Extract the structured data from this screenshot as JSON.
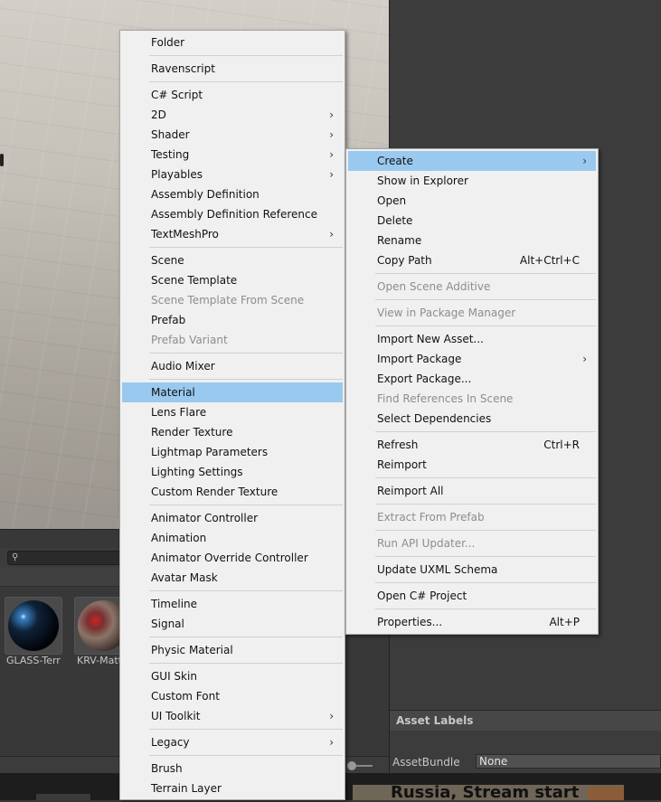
{
  "project_panel": {
    "assets": [
      {
        "name": "GLASS-Terr"
      },
      {
        "name": "KRV-Matt"
      }
    ]
  },
  "inspector": {
    "asset_labels_title": "Asset Labels",
    "assetbundle_label": "AssetBundle",
    "assetbundle_value": "None"
  },
  "bottom_strip": {
    "text": "Russia, Stream start"
  },
  "create_menu": {
    "items": [
      {
        "label": "Folder"
      },
      {
        "label": "Ravenscript"
      },
      {
        "label": "C# Script"
      },
      {
        "label": "2D",
        "submenu": true
      },
      {
        "label": "Shader",
        "submenu": true
      },
      {
        "label": "Testing",
        "submenu": true
      },
      {
        "label": "Playables",
        "submenu": true
      },
      {
        "label": "Assembly Definition"
      },
      {
        "label": "Assembly Definition Reference"
      },
      {
        "label": "TextMeshPro",
        "submenu": true
      },
      {
        "label": "Scene"
      },
      {
        "label": "Scene Template"
      },
      {
        "label": "Scene Template From Scene",
        "disabled": true
      },
      {
        "label": "Prefab"
      },
      {
        "label": "Prefab Variant",
        "disabled": true
      },
      {
        "label": "Audio Mixer"
      },
      {
        "label": "Material",
        "highlighted": true
      },
      {
        "label": "Lens Flare"
      },
      {
        "label": "Render Texture"
      },
      {
        "label": "Lightmap Parameters"
      },
      {
        "label": "Lighting Settings"
      },
      {
        "label": "Custom Render Texture"
      },
      {
        "label": "Animator Controller"
      },
      {
        "label": "Animation"
      },
      {
        "label": "Animator Override Controller"
      },
      {
        "label": "Avatar Mask"
      },
      {
        "label": "Timeline"
      },
      {
        "label": "Signal"
      },
      {
        "label": "Physic Material"
      },
      {
        "label": "GUI Skin"
      },
      {
        "label": "Custom Font"
      },
      {
        "label": "UI Toolkit",
        "submenu": true
      },
      {
        "label": "Legacy",
        "submenu": true
      },
      {
        "label": "Brush"
      },
      {
        "label": "Terrain Layer"
      }
    ]
  },
  "context_menu": {
    "items": [
      {
        "label": "Create",
        "submenu": true,
        "highlighted": true
      },
      {
        "label": "Show in Explorer"
      },
      {
        "label": "Open"
      },
      {
        "label": "Delete"
      },
      {
        "label": "Rename"
      },
      {
        "label": "Copy Path",
        "shortcut": "Alt+Ctrl+C"
      },
      {
        "label": "Open Scene Additive",
        "disabled": true
      },
      {
        "label": "View in Package Manager",
        "disabled": true
      },
      {
        "label": "Import New Asset..."
      },
      {
        "label": "Import Package",
        "submenu": true
      },
      {
        "label": "Export Package..."
      },
      {
        "label": "Find References In Scene",
        "disabled": true
      },
      {
        "label": "Select Dependencies"
      },
      {
        "label": "Refresh",
        "shortcut": "Ctrl+R"
      },
      {
        "label": "Reimport"
      },
      {
        "label": "Reimport All"
      },
      {
        "label": "Extract From Prefab",
        "disabled": true
      },
      {
        "label": "Run API Updater...",
        "disabled": true
      },
      {
        "label": "Update UXML Schema"
      },
      {
        "label": "Open C# Project"
      },
      {
        "label": "Properties...",
        "shortcut": "Alt+P"
      }
    ]
  }
}
